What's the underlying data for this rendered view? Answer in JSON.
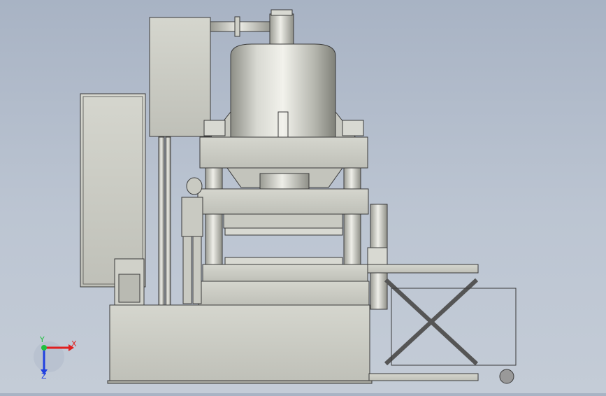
{
  "viewport": {
    "background_top": "#a8b3c4",
    "background_bottom": "#c4ccd7"
  },
  "model": {
    "colors": {
      "metal": "#cfd0c8",
      "metal_dark": "#9fa097",
      "outline": "#3a3a3a",
      "dome_light": "#f0f0ea",
      "dome_dark": "#8d8e86"
    }
  },
  "triad": {
    "x_label": "X",
    "y_label": "Y",
    "z_label": "Z",
    "x_color": "#e02020",
    "y_color": "#20c040",
    "z_color": "#2040e0"
  }
}
